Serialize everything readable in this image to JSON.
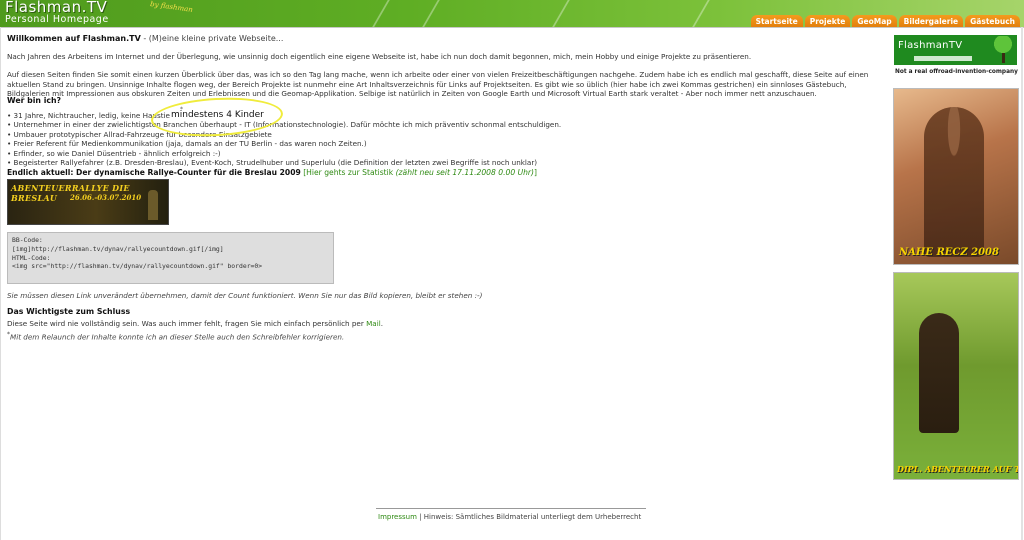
{
  "header": {
    "logo_title": "Flashman.TV",
    "logo_subtitle": "Personal Homepage",
    "logo_by": "by flashman",
    "nav": [
      "Startseite",
      "Projekte",
      "GeoMap",
      "Bildergalerie",
      "Gästebuch"
    ],
    "colors": {
      "header_green": "#5fae24",
      "tab_orange": "#e88a12",
      "link_green": "#2f8a13",
      "caption_yellow": "#f6d300"
    }
  },
  "welcome": {
    "title": "Willkommen auf Flashman.TV",
    "subtitle": " - (M)eine kleine private Webseite..."
  },
  "para1": "Nach Jahren des Arbeitens im Internet und der Überlegung, wie unsinnig doch eigentlich eine eigene Webseite ist, habe ich nun doch damit begonnen, mich, mein Hobby und einige Projekte zu präsentieren.",
  "para2": "Auf diesen Seiten finden Sie somit einen kurzen Überblick über das, was ich so den Tag lang mache, wenn ich arbeite oder einer von vielen Freizeitbeschäftigungen nachgehe. Zudem habe ich es endlich mal geschafft, diese Seite auf einen aktuellen Stand zu bringen. Unsinnige Inhalte flogen weg, der Bereich Projekte ist nunmehr eine Art Inhaltsverzeichnis für Links auf Projektseiten. Es gibt wie so üblich (hier habe ich zwei Kommas gestrichen) ein sinnloses Gästebuch, Bildgalerien mit Impressionen aus obskuren Zeiten und Erlebnissen und die Geomap-Applikation. Selbige ist natürlich in Zeiten von Google Earth und Microsoft Virtual Earth stark veraltet - Aber noch immer nett anzuschauen.",
  "who_heading": "Wer bin ich?",
  "bullets": [
    "• 31 Jahre, Nichtraucher, ledig, keine Haustiere",
    "• Unternehmer in einer der zwielichtigsten Branchen überhaupt - IT (Informationstechnologie). Dafür möchte ich mich präventiv schonmal entschuldigen.",
    "• Umbauer prototypischer Allrad-Fahrzeuge für besondere Einsatzgebiete",
    "• Freier Referent für Medienkommunikation (jaja, damals an der TU Berlin - das waren noch Zeiten.)",
    "• Erfinder, so wie Daniel Düsentrieb - ähnlich erfolgreich :-)",
    "• Begeisterter Rallyefahrer (z.B. Dresden-Breslau), Event-Koch, Strudelhuber und Superlulu (die Definition der letzten zwei Begriffe ist noch unklar)"
  ],
  "annotation": {
    "star": "*",
    "text": "mindestens 4 Kinder"
  },
  "aktuell": {
    "heading": "Endlich aktuell: Der dynamische Rallye-Counter für die Breslau 2009",
    "link": "Hier gehts zur Statistik",
    "link_note": "(zählt neu seit 17.11.2008 0.00 Uhr)"
  },
  "banner": {
    "line1": "ABENTEUERRALLYE DIE BRESLAU",
    "line2": "26.06.-03.07.2010"
  },
  "codebox": [
    "BB-Code:",
    "[img]http://flashman.tv/dynav/rallyecountdown.gif[/img]",
    "",
    "HTML-Code:",
    "<img src=\"http://flashman.tv/dynav/rallyecountdown.gif\" border=0>"
  ],
  "note": "Sie müssen diesen Link unverändert übernehmen, damit der Count funktioniert. Wenn Sie nur das Bild kopieren, bleibt er stehen :-)",
  "wichtig": {
    "heading": "Das Wichtigste zum Schluss",
    "text": "Diese Seite wird nie vollständig sein. Was auch immer fehlt, fragen Sie mich einfach persönlich per ",
    "mail": "Mail",
    "end": "."
  },
  "footnote": {
    "star": "*",
    "text": "Mit dem Relaunch der Inhalte konnte ich an dieser Stelle auch den Schreibfehler korrigieren."
  },
  "sidebar": {
    "logo": "FlashmanTV",
    "tagline": "Not a real offroad-invention-company",
    "photo1_caption": "NAHE RECZ 2008",
    "photo2_caption": "DIPL. ABENTEURER AUF TOUR"
  },
  "footer": {
    "impressum": "Impressum",
    "sep": " | ",
    "text": "Hinweis: Sämtliches Bildmaterial unterliegt dem Urheberrecht"
  }
}
